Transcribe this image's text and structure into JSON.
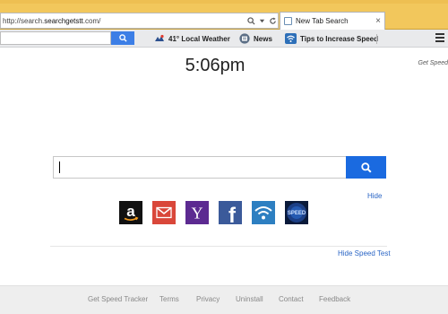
{
  "browser": {
    "address": {
      "prefix": "http://search.",
      "host": "searchgetstt",
      "suffix": ".com/"
    },
    "tab": {
      "title": "New Tab Search",
      "close_glyph": "×"
    }
  },
  "toolbar": {
    "weather_label": "41° Local Weather",
    "news_label": "News",
    "tips_label": "Tips to Increase Speed",
    "icons": [
      "search-icon",
      "weather-icon",
      "news-icon",
      "wifi-icon",
      "menu-icon"
    ]
  },
  "page": {
    "time": "5:06pm",
    "get_speed_label": "Get Speed",
    "hide_label": "Hide",
    "hide_speed_test_label": "Hide Speed Test"
  },
  "tiles": [
    {
      "name": "amazon",
      "color": "#111111",
      "glyph": "a"
    },
    {
      "name": "gmail",
      "color": "#d9473a",
      "glyph": "M"
    },
    {
      "name": "yahoo",
      "color": "#5c2a91",
      "glyph": "Y"
    },
    {
      "name": "facebook",
      "color": "#3b5a9a",
      "glyph": "f"
    },
    {
      "name": "wifi",
      "color": "#2d7fc1",
      "glyph": "wifi"
    },
    {
      "name": "speed",
      "color": "#0a1a3a",
      "glyph": "SPEED"
    }
  ],
  "footer": {
    "links": [
      "Get Speed Tracker",
      "Terms",
      "Privacy",
      "Uninstall",
      "Contact",
      "Feedback"
    ]
  },
  "colors": {
    "chrome": "#f2c75c",
    "search_button": "#1a6ae0",
    "link": "#2a65c5"
  }
}
